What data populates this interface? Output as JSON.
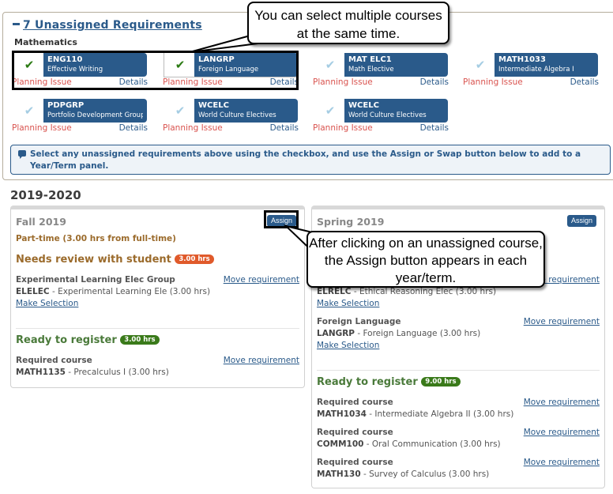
{
  "unassigned": {
    "title": "7 Unassigned Requirements",
    "collapse_icon": "minus-icon",
    "subject": "Mathematics",
    "requirements": [
      {
        "code": "ENG110",
        "name": "Effective Writing",
        "checked": true,
        "issue": "Planning Issue",
        "details": "Details"
      },
      {
        "code": "LANGRP",
        "name": "Foreign Language",
        "checked": true,
        "issue": "Planning Issue",
        "details": "Details"
      },
      {
        "code": "MAT ELC1",
        "name": "Math Elective",
        "checked": false,
        "issue": "Planning Issue",
        "details": "Details"
      },
      {
        "code": "MATH1033",
        "name": "Intermediate Algebra I",
        "checked": false,
        "issue": "Planning Issue",
        "details": "Details"
      },
      {
        "code": "PDPGRP",
        "name": "Portfolio Development Group",
        "checked": false,
        "issue": "Planning Issue",
        "details": "Details"
      },
      {
        "code": "WCELC",
        "name": "World Culture Electives",
        "checked": false,
        "issue": "Planning Issue",
        "details": "Details"
      },
      {
        "code": "WCELC",
        "name": "World Culture Electives",
        "checked": false,
        "issue": "Planning Issue",
        "details": "Details"
      }
    ],
    "info_message": "Select any unassigned requirements above using the checkbox, and use the Assign or Swap button below to add to a Year/Term panel."
  },
  "year": {
    "title": "2019-2020",
    "terms": [
      {
        "name": "Fall 2019",
        "assign_label": "Assign",
        "load_status": "Part-time (3.00 hrs from full-time)",
        "review_heading": "Needs review with student",
        "review_hours": "3.00 hrs",
        "review_items": [
          {
            "title": "Experimental Learning Elec Group",
            "code": "ELELEC",
            "desc": " - Experimental Learning Ele (3.00 hrs)",
            "move": "Move requirement",
            "make_selection": "Make Selection"
          }
        ],
        "ready_heading": "Ready to register",
        "ready_hours": "3.00 hrs",
        "ready_items": [
          {
            "title": "Required course",
            "code": "MATH1135",
            "desc": " - Precalculus I (3.00 hrs)",
            "move": "Move requirement"
          }
        ]
      },
      {
        "name": "Spring 2019",
        "assign_label": "Assign",
        "review_items": [
          {
            "title": "",
            "code": "ELRELC",
            "desc": " - Ethical Reasoning Elec (3.00 hrs)",
            "move": "Move requirement",
            "make_selection": "Make Selection"
          },
          {
            "title": "Foreign Language",
            "code": "LANGRP",
            "desc": " - Foreign Language (3.00 hrs)",
            "move": "Move requirement",
            "make_selection": "Make Selection"
          }
        ],
        "ready_heading": "Ready to register",
        "ready_hours": "9.00 hrs",
        "ready_items": [
          {
            "title": "Required course",
            "code": "MATH1034",
            "desc": " - Intermediate Algebra II (3.00 hrs)",
            "move": "Move requirement"
          },
          {
            "title": "Required course",
            "code": "COMM100",
            "desc": " - Oral Communication (3.00 hrs)",
            "move": "Move requirement"
          },
          {
            "title": "Required course",
            "code": "MATH130",
            "desc": " - Survey of Calculus (3.00 hrs)",
            "move": "Move requirement"
          }
        ]
      }
    ]
  },
  "callouts": {
    "multi_select": "You can select multiple courses at the same time.",
    "assign_button": "After clicking on an unassigned course, the Assign button appears in each year/term."
  },
  "colors": {
    "brand": "#2a5a8a",
    "planning_issue": "#d9534f",
    "review": "#9b6b2c",
    "ready": "#4a7a3a",
    "review_pill": "#e05a2b",
    "ready_pill": "#3a7a1a"
  }
}
